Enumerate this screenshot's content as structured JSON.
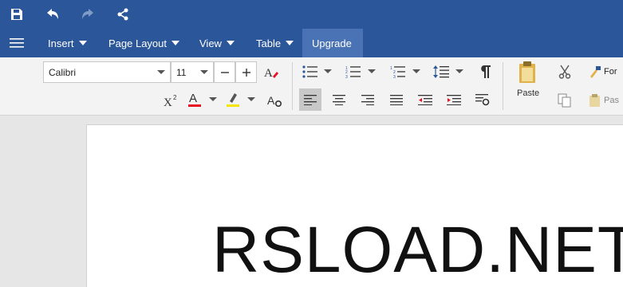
{
  "menu": {
    "items": [
      {
        "label": "Insert"
      },
      {
        "label": "Page Layout"
      },
      {
        "label": "View"
      },
      {
        "label": "Table"
      }
    ],
    "upgrade_label": "Upgrade"
  },
  "ribbon": {
    "font_family": "Calibri",
    "font_size": "11",
    "paste_label": "Paste",
    "format_painter_label": "For",
    "paste_special_label": "Pas"
  },
  "document": {
    "text": "RSLOAD.NET"
  },
  "colors": {
    "accent": "#2b579a",
    "upgrade_bg": "#4a73b5",
    "font_color": "#e81123",
    "highlight_color": "#f4e400"
  }
}
